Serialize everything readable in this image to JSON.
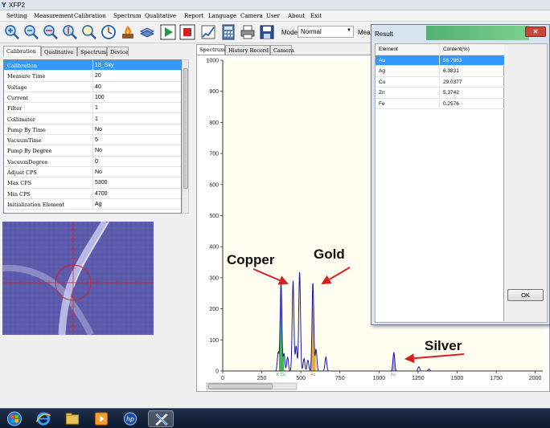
{
  "window": {
    "title": "XFP2"
  },
  "menu": [
    "Setting",
    "Measurement",
    "Calibration",
    "Spectrum",
    "Qualitative",
    "Report",
    "Language",
    "Camera",
    "User",
    "About",
    "Exit"
  ],
  "toolbar": {
    "mode_label": "Mode",
    "mode_value": "Normal",
    "meas_label": "Meas"
  },
  "left_tabs": [
    "Calibration",
    "Qualitative",
    "Spectrum",
    "Device"
  ],
  "params": [
    {
      "name": "Calibration",
      "value": "13_Sky"
    },
    {
      "name": "Measure Time",
      "value": "20"
    },
    {
      "name": "Voltage",
      "value": "40"
    },
    {
      "name": "Current",
      "value": "100"
    },
    {
      "name": "Filter",
      "value": "1"
    },
    {
      "name": "Collimator",
      "value": "1"
    },
    {
      "name": "Pump By Time",
      "value": "No"
    },
    {
      "name": "VacuumTime",
      "value": "5"
    },
    {
      "name": "Pump By Degree",
      "value": "No"
    },
    {
      "name": "VacuumDegree",
      "value": "0"
    },
    {
      "name": "Adjust CPS",
      "value": "No"
    },
    {
      "name": "Max CPS",
      "value": "5300"
    },
    {
      "name": "Min CPS",
      "value": "4700"
    },
    {
      "name": "Initialization Element",
      "value": "Ag"
    }
  ],
  "spectrum_tabs": [
    "Spectrum",
    "History Record",
    "Camera"
  ],
  "annotations": {
    "copper": "Copper",
    "gold": "Gold",
    "silver": "Silver"
  },
  "result": {
    "title": "Result",
    "headers": [
      "Element",
      "Content(%)"
    ],
    "rows": [
      {
        "element": "Au",
        "content": "58.7863"
      },
      {
        "element": "Ag",
        "content": "6.3831"
      },
      {
        "element": "Cu",
        "content": "29.0377"
      },
      {
        "element": "Zn",
        "content": "5.3742"
      },
      {
        "element": "Fe",
        "content": "0.2576"
      }
    ],
    "ok_label": "OK"
  },
  "chart_data": {
    "type": "line",
    "xlim": [
      0,
      2048
    ],
    "ylim": [
      0,
      1000
    ],
    "x_ticks": [
      0,
      250,
      500,
      750,
      1000,
      1250,
      1500,
      1750,
      2000
    ],
    "y_ticks": [
      0,
      100,
      200,
      300,
      400,
      500,
      600,
      700,
      800,
      900,
      1000
    ],
    "peaks": [
      {
        "x": 355,
        "y": 60
      },
      {
        "x": 373,
        "y": 285
      },
      {
        "x": 392,
        "y": 55
      },
      {
        "x": 415,
        "y": 45
      },
      {
        "x": 450,
        "y": 290
      },
      {
        "x": 470,
        "y": 80
      },
      {
        "x": 492,
        "y": 318
      },
      {
        "x": 520,
        "y": 40
      },
      {
        "x": 545,
        "y": 35
      },
      {
        "x": 577,
        "y": 285
      },
      {
        "x": 597,
        "y": 70
      },
      {
        "x": 660,
        "y": 45
      },
      {
        "x": 1095,
        "y": 60
      },
      {
        "x": 1255,
        "y": 14
      },
      {
        "x": 1320,
        "y": 6
      }
    ],
    "colored_regions": [
      {
        "element": "Cu",
        "color": "#2fa84a",
        "from": 360,
        "to": 392
      },
      {
        "element": "Au",
        "color": "#e6a21f",
        "from": 560,
        "to": 595
      },
      {
        "element": "Ag",
        "color": "#a9a9d8",
        "from": 1075,
        "to": 1115
      }
    ],
    "element_markers": [
      {
        "label": "K Cu",
        "x": 372,
        "color": "#2fa84a"
      },
      {
        "label": "Au",
        "x": 577,
        "color": "#d8941a"
      },
      {
        "label": "Ag",
        "x": 1090,
        "color": "#8f8fc9"
      }
    ]
  },
  "colors": {
    "selection": "#3399ff",
    "spectrum": "#1a1aa8",
    "arrow": "#d82020"
  }
}
